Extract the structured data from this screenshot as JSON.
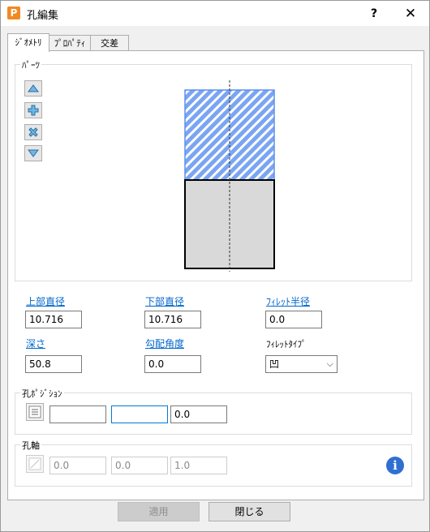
{
  "window": {
    "title": "孔編集",
    "help_label": "?",
    "close_label": "✕"
  },
  "tabs": [
    {
      "label": "ｼﾞｵﾒﾄﾘ",
      "active": true
    },
    {
      "label": "ﾌﾟﾛﾊﾟﾃｨ",
      "active": false
    },
    {
      "label": "交差",
      "active": false
    }
  ],
  "parts": {
    "group_label": "ﾊﾟｰﾂ",
    "tools": [
      "move-up-icon",
      "add-part-icon",
      "delete-part-icon",
      "move-down-icon"
    ]
  },
  "params": {
    "top_diameter": {
      "label": "上部直径",
      "value": "10.716"
    },
    "bottom_diameter": {
      "label": "下部直径",
      "value": "10.716"
    },
    "fillet_radius": {
      "label": "ﾌｨﾚｯﾄ半径",
      "value": "0.0"
    },
    "depth": {
      "label": "深さ",
      "value": "50.8"
    },
    "draft_angle": {
      "label": "勾配角度",
      "value": "0.0"
    },
    "fillet_type": {
      "label": "ﾌｨﾚｯﾄﾀｲﾌﾟ",
      "value": "凹"
    }
  },
  "position": {
    "group_label": "孔ﾎﾟｼﾞｼｮﾝ",
    "x": "",
    "y": "",
    "z": "0.0"
  },
  "axis": {
    "group_label": "孔軸",
    "x": "0.0",
    "y": "0.0",
    "z": "1.0"
  },
  "buttons": {
    "apply": "適用",
    "close": "閉じる"
  },
  "colors": {
    "hatch": "#5b8ff0",
    "body": "#d9d9d9",
    "accent": "#0078d7",
    "link": "#0066cc"
  }
}
